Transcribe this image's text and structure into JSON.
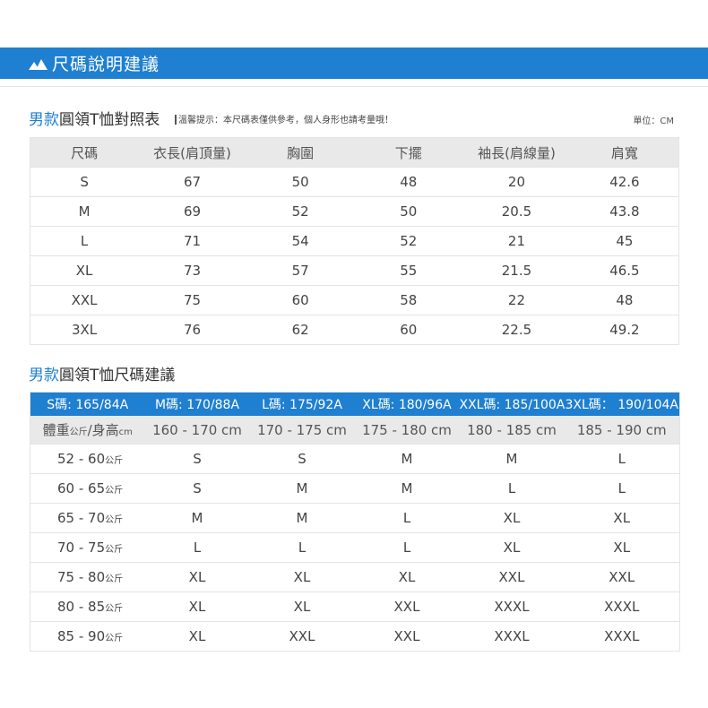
{
  "banner": {
    "title": "尺碼說明建議"
  },
  "section1": {
    "title_highlight": "男款",
    "title_rest": "圓領T恤對照表",
    "notice": "溫馨提示：本尺碼表僅供參考，個人身形也請考量哦！",
    "unit": "單位：CM",
    "headers": [
      "尺碼",
      "衣長(肩頂量)",
      "胸圍",
      "下擺",
      "袖長(肩線量)",
      "肩寬"
    ],
    "rows": [
      [
        "S",
        "67",
        "50",
        "48",
        "20",
        "42.6"
      ],
      [
        "M",
        "69",
        "52",
        "50",
        "20.5",
        "43.8"
      ],
      [
        "L",
        "71",
        "54",
        "52",
        "21",
        "45"
      ],
      [
        "XL",
        "73",
        "57",
        "55",
        "21.5",
        "46.5"
      ],
      [
        "XXL",
        "75",
        "60",
        "58",
        "22",
        "48"
      ],
      [
        "3XL",
        "76",
        "62",
        "60",
        "22.5",
        "49.2"
      ]
    ]
  },
  "section2": {
    "title_highlight": "男款",
    "title_rest": "圓領T恤尺碼建議",
    "size_labels": [
      "S碼: 165/84A",
      "M碼: 170/88A",
      "L碼: 175/92A",
      "XL碼: 180/96A",
      "XXL碼: 185/100A",
      "3XL碼： 190/104A"
    ],
    "sub_header": {
      "weight_label": "體重",
      "weight_unit": "公斤",
      "height_label": "/身高",
      "height_unit": "cm",
      "heights": [
        "160 - 170 cm",
        "170 - 175 cm",
        "175 - 180 cm",
        "180 - 185 cm",
        "185 - 190 cm"
      ]
    },
    "rows": [
      {
        "weight": "52 - 60",
        "unit": "公斤",
        "sizes": [
          "S",
          "S",
          "M",
          "M",
          "L"
        ]
      },
      {
        "weight": "60 - 65",
        "unit": "公斤",
        "sizes": [
          "S",
          "M",
          "M",
          "L",
          "L"
        ]
      },
      {
        "weight": "65 - 70",
        "unit": "公斤",
        "sizes": [
          "M",
          "M",
          "L",
          "XL",
          "XL"
        ]
      },
      {
        "weight": "70 - 75",
        "unit": "公斤",
        "sizes": [
          "L",
          "L",
          "L",
          "XL",
          "XL"
        ]
      },
      {
        "weight": "75 - 80",
        "unit": "公斤",
        "sizes": [
          "XL",
          "XL",
          "XL",
          "XXL",
          "XXL"
        ]
      },
      {
        "weight": "80 - 85",
        "unit": "公斤",
        "sizes": [
          "XL",
          "XL",
          "XXL",
          "XXXL",
          "XXXL"
        ]
      },
      {
        "weight": "85 - 90",
        "unit": "公斤",
        "sizes": [
          "XL",
          "XXL",
          "XXL",
          "XXXL",
          "XXXL"
        ]
      }
    ]
  },
  "colors": {
    "accent": "#1f7fd0",
    "header_bg": "#e9e9e9"
  }
}
